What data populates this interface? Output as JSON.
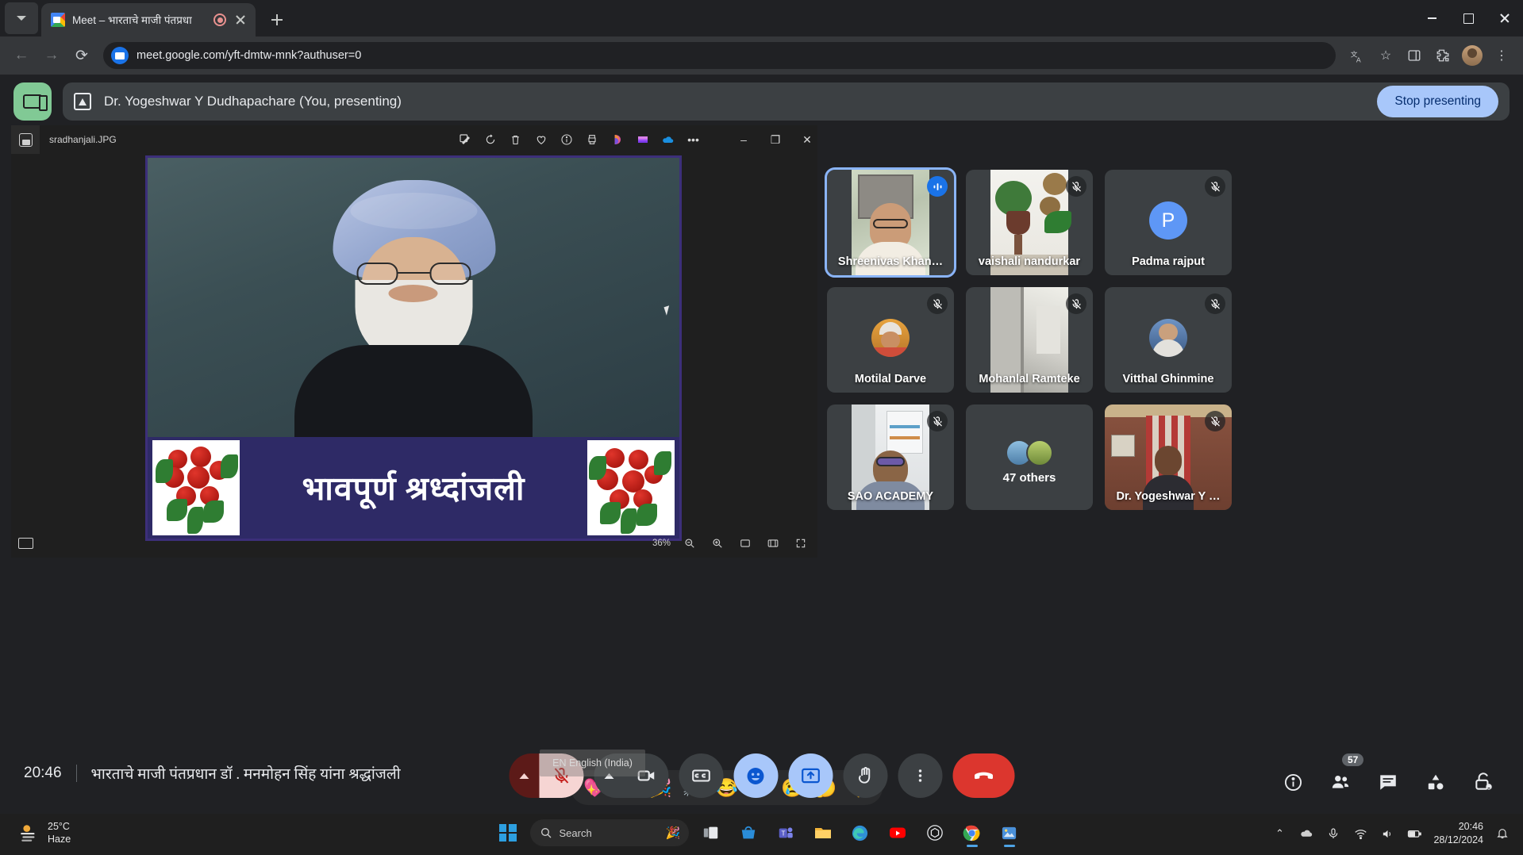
{
  "browser": {
    "tab": {
      "title": "Meet – भारताचे माजी पंतप्रधा",
      "favicon": "google-meet-favicon",
      "recording": "recording-indicator"
    },
    "new_tab_label": "+",
    "url": "meet.google.com/yft-dmtw-mnk?authuser=0",
    "window_controls": {
      "minimize": "minimize-icon",
      "maximize": "maximize-icon",
      "close": "close-icon"
    },
    "toolbar_icons": [
      "translate-icon",
      "bookmark-star-icon",
      "side-panel-icon",
      "extensions-icon",
      "profile-avatar",
      "more-menu-icon"
    ]
  },
  "present_bar": {
    "cast_icon": "cast-screen-icon",
    "presenting_icon": "present-to-all-icon",
    "presenter": "Dr. Yogeshwar Y Dudhapachare (You, presenting)",
    "stop_label": "Stop presenting"
  },
  "photo_viewer": {
    "filename": "sradhanjali.JPG",
    "thumbnail_icon": "image-thumbnail-icon",
    "tools": [
      "edit-image-icon",
      "rotate-icon",
      "delete-icon",
      "favorite-heart-icon",
      "info-icon",
      "print-icon",
      "designer-icon",
      "clipchamp-icon",
      "onedrive-icon",
      "more-options-icon"
    ],
    "window_controls": {
      "minimize": "minimize-icon",
      "restore": "restore-icon",
      "close": "close-icon"
    },
    "zoom_level": "36%",
    "bottom_icons": [
      "filmstrip-icon",
      "zoom-out-icon",
      "zoom-in-icon",
      "actual-size-icon",
      "fit-to-window-icon",
      "fullscreen-icon"
    ],
    "slide": {
      "banner_text": "भावपूर्ण श्रध्दांजली",
      "subject": "portrait-of-manmohan-singh"
    }
  },
  "participants": [
    {
      "name": "Shreenivas Khan…",
      "mic": "active-speaker",
      "speaking": true,
      "media": "video"
    },
    {
      "name": "vaishali nandurkar",
      "mic": "muted",
      "speaking": false,
      "media": "video"
    },
    {
      "name": "Padma rajput",
      "mic": "muted",
      "speaking": false,
      "media": "avatar-letter",
      "letter": "P"
    },
    {
      "name": "Motilal Darve",
      "mic": "muted",
      "speaking": false,
      "media": "avatar-photo"
    },
    {
      "name": "Mohanlal Ramteke",
      "mic": "muted",
      "speaking": false,
      "media": "video"
    },
    {
      "name": "Vitthal Ghinmine",
      "mic": "muted",
      "speaking": false,
      "media": "avatar-photo"
    },
    {
      "name": "SAO ACADEMY",
      "mic": "muted",
      "speaking": false,
      "media": "video"
    },
    {
      "name": "47 others",
      "mic": "none",
      "speaking": false,
      "media": "avatar-stack"
    },
    {
      "name": "Dr. Yogeshwar Y …",
      "mic": "muted",
      "speaking": false,
      "media": "video"
    }
  ],
  "reactions": [
    "💖",
    "👍",
    "🎉",
    "👏",
    "😂",
    "😮",
    "😢",
    "🤔",
    "👎"
  ],
  "meet_bottom": {
    "time": "20:46",
    "meeting_title": "भारताचे माजी पंतप्रधान डॉ . मनमोहन सिंह यांना श्रद्धांजली",
    "controls": [
      {
        "name": "microphone-options-arrow",
        "icon": "chevron-up-icon"
      },
      {
        "name": "microphone-toggle",
        "icon": "mic-off-icon",
        "state": "muted"
      },
      {
        "name": "camera-options-arrow",
        "icon": "chevron-up-icon"
      },
      {
        "name": "camera-toggle",
        "icon": "video-camera-icon",
        "state": "on"
      },
      {
        "name": "captions-toggle",
        "icon": "closed-captions-icon"
      },
      {
        "name": "reactions-button",
        "icon": "emoji-smiley-icon",
        "state": "active"
      },
      {
        "name": "present-now-button",
        "icon": "present-to-all-icon",
        "state": "active"
      },
      {
        "name": "raise-hand-button",
        "icon": "raised-hand-icon"
      },
      {
        "name": "more-options-button",
        "icon": "more-vertical-icon"
      },
      {
        "name": "leave-call-button",
        "icon": "end-call-icon"
      }
    ],
    "right_controls": [
      {
        "name": "meeting-details-button",
        "icon": "info-circle-icon"
      },
      {
        "name": "participants-button",
        "icon": "people-icon",
        "badge": "57"
      },
      {
        "name": "chat-button",
        "icon": "chat-bubble-icon"
      },
      {
        "name": "activities-button",
        "icon": "shapes-icon"
      },
      {
        "name": "host-controls-button",
        "icon": "lock-person-icon"
      }
    ]
  },
  "ime_tooltip": "EN English (India)",
  "taskbar": {
    "weather": {
      "temp": "25°C",
      "condition": "Haze",
      "icon": "haze-weather-icon"
    },
    "start_icon": "windows-start-icon",
    "search_placeholder": "Search",
    "search_decoration": "copilot-confetti-icon",
    "apps": [
      "task-view-icon",
      "microsoft-store-icon",
      "teams-icon",
      "file-explorer-icon",
      "edge-icon",
      "youtube-icon",
      "chatgpt-icon",
      "chrome-icon",
      "photos-icon"
    ],
    "tray": [
      "show-hidden-icons-icon",
      "onedrive-icon",
      "microphone-icon",
      "wifi-icon",
      "volume-icon",
      "battery-icon"
    ],
    "clock_time": "20:46",
    "clock_date": "28/12/2024",
    "notification_icon": "notification-bell-icon"
  }
}
